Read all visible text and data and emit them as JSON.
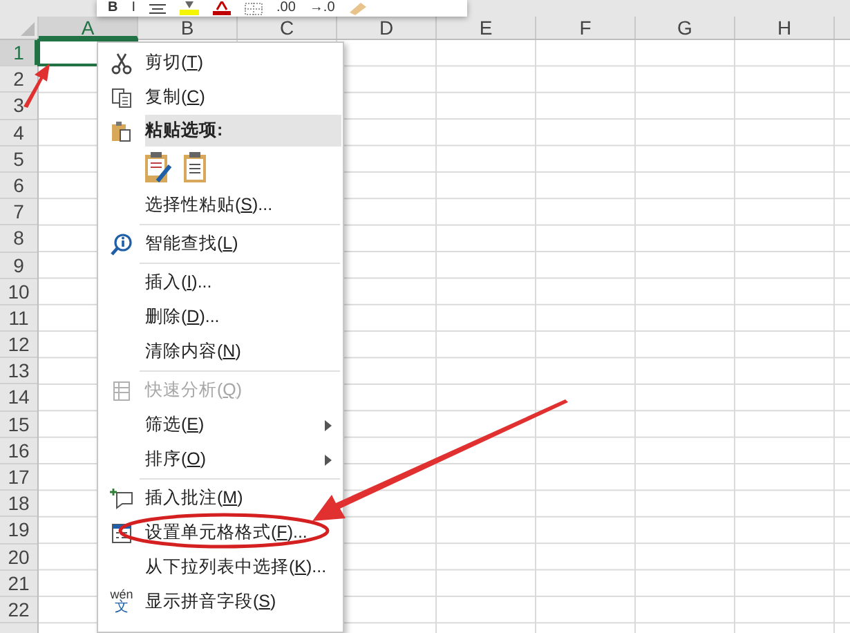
{
  "mini_toolbar": {
    "items": [
      {
        "kind": "text",
        "text": "B",
        "bold": true
      },
      {
        "kind": "text",
        "text": "I",
        "bold": false
      },
      {
        "kind": "icon"
      },
      {
        "kind": "icon"
      },
      {
        "kind": "icon"
      },
      {
        "kind": "icon"
      },
      {
        "kind": "text",
        "text": ".00",
        "bold": false
      },
      {
        "kind": "text",
        "text": "→.0",
        "bold": false
      },
      {
        "kind": "icon"
      }
    ]
  },
  "sheet": {
    "columns": [
      {
        "label": "A",
        "selected": true
      },
      {
        "label": "B",
        "selected": false
      },
      {
        "label": "C",
        "selected": false
      },
      {
        "label": "D",
        "selected": false
      },
      {
        "label": "E",
        "selected": false
      },
      {
        "label": "F",
        "selected": false
      },
      {
        "label": "G",
        "selected": false
      },
      {
        "label": "H",
        "selected": false
      }
    ],
    "rows": [
      {
        "label": "1",
        "selected": true
      },
      {
        "label": "2",
        "selected": false
      },
      {
        "label": "3",
        "selected": false
      },
      {
        "label": "4",
        "selected": false
      },
      {
        "label": "5",
        "selected": false
      },
      {
        "label": "6",
        "selected": false
      },
      {
        "label": "7",
        "selected": false
      },
      {
        "label": "8",
        "selected": false
      },
      {
        "label": "9",
        "selected": false
      },
      {
        "label": "10",
        "selected": false
      },
      {
        "label": "11",
        "selected": false
      },
      {
        "label": "12",
        "selected": false
      },
      {
        "label": "13",
        "selected": false
      },
      {
        "label": "14",
        "selected": false
      },
      {
        "label": "15",
        "selected": false
      },
      {
        "label": "16",
        "selected": false
      },
      {
        "label": "17",
        "selected": false
      },
      {
        "label": "18",
        "selected": false
      },
      {
        "label": "19",
        "selected": false
      },
      {
        "label": "20",
        "selected": false
      },
      {
        "label": "21",
        "selected": false
      },
      {
        "label": "22",
        "selected": false
      }
    ]
  },
  "context_menu": {
    "items": [
      {
        "kind": "command",
        "before": "剪切(",
        "key": "T",
        "after": ")",
        "disabled": false,
        "submenu": false
      },
      {
        "kind": "command",
        "before": "复制(",
        "key": "C",
        "after": ")",
        "disabled": false,
        "submenu": false
      },
      {
        "kind": "header",
        "text": "粘贴选项:"
      },
      {
        "kind": "paste_options"
      },
      {
        "kind": "command",
        "before": "选择性粘贴(",
        "key": "S",
        "after": ")...",
        "disabled": false,
        "submenu": false
      },
      {
        "kind": "separator"
      },
      {
        "kind": "command",
        "before": "智能查找(",
        "key": "L",
        "after": ")",
        "disabled": false,
        "submenu": false
      },
      {
        "kind": "separator"
      },
      {
        "kind": "command",
        "before": "插入(",
        "key": "I",
        "after": ")...",
        "disabled": false,
        "submenu": false
      },
      {
        "kind": "command",
        "before": "删除(",
        "key": "D",
        "after": ")...",
        "disabled": false,
        "submenu": false
      },
      {
        "kind": "command",
        "before": "清除内容(",
        "key": "N",
        "after": ")",
        "disabled": false,
        "submenu": false
      },
      {
        "kind": "separator"
      },
      {
        "kind": "command",
        "before": "快速分析(",
        "key": "Q",
        "after": ")",
        "disabled": true,
        "submenu": false
      },
      {
        "kind": "command",
        "before": "筛选(",
        "key": "E",
        "after": ")",
        "disabled": false,
        "submenu": true
      },
      {
        "kind": "command",
        "before": "排序(",
        "key": "O",
        "after": ")",
        "disabled": false,
        "submenu": true
      },
      {
        "kind": "separator"
      },
      {
        "kind": "command",
        "before": "插入批注(",
        "key": "M",
        "after": ")",
        "disabled": false,
        "submenu": false
      },
      {
        "kind": "command",
        "before": "设置单元格格式(",
        "key": "F",
        "after": ")...",
        "disabled": false,
        "submenu": false
      },
      {
        "kind": "command",
        "before": "从下拉列表中选择(",
        "key": "K",
        "after": ")...",
        "disabled": false,
        "submenu": false
      },
      {
        "kind": "command",
        "icon_text": "wén",
        "icon_char": "文",
        "before": "显示拼音字段(",
        "key": "S",
        "after": ")",
        "disabled": false,
        "submenu": false
      }
    ]
  }
}
